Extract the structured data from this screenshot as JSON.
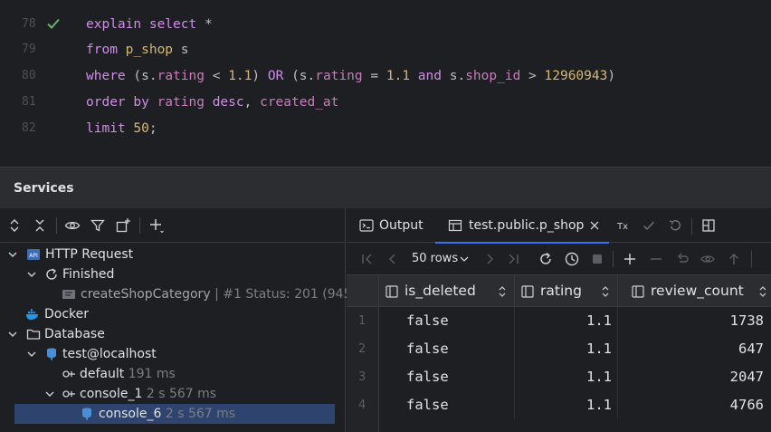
{
  "editor": {
    "lines": [
      {
        "no": "78",
        "status": "check-icon"
      },
      {
        "no": "79"
      },
      {
        "no": "80"
      },
      {
        "no": "81"
      },
      {
        "no": "82"
      }
    ],
    "code": {
      "l78": {
        "a": "explain select",
        "b": "*"
      },
      "l79": {
        "a": "from",
        "b": "p_shop",
        "c": "s"
      },
      "l80": {
        "a": "where",
        "b": "(s.",
        "c": "rating",
        "d": "<",
        "e": "1.1",
        "f": ")",
        "g": "OR",
        "h": "(s.",
        "i": "rating",
        "j": "=",
        "k": "1.1",
        "l": "and",
        "m": "s.",
        "n": "shop_id",
        "o": ">",
        "p": "12960943",
        "q": ")"
      },
      "l81": {
        "a": "order by",
        "b": "rating",
        "c": "desc",
        "d": ",",
        "e": "created_at"
      },
      "l82": {
        "a": "limit",
        "b": "50",
        "c": ";"
      }
    }
  },
  "services": {
    "title": "Services",
    "tree": [
      {
        "label": "HTTP Request"
      },
      {
        "label": "Finished"
      },
      {
        "label": "createShopCategory",
        "meta": "| #1 Status: 201 (945"
      },
      {
        "label": "Docker"
      },
      {
        "label": "Database"
      },
      {
        "label": "test@localhost"
      },
      {
        "label": "default",
        "meta": "191 ms"
      },
      {
        "label": "console_1",
        "meta": "2 s 567 ms"
      },
      {
        "label": "console_6",
        "meta": "2 s 567 ms"
      }
    ]
  },
  "results": {
    "tabs": [
      {
        "label": "Output"
      },
      {
        "label": "test.public.p_shop"
      }
    ],
    "rows_selector": "50 rows",
    "columns": [
      "is_deleted",
      "rating",
      "review_count"
    ],
    "rows": [
      {
        "n": "1",
        "is_deleted": "false",
        "rating": "1.1",
        "review_count": "1738"
      },
      {
        "n": "2",
        "is_deleted": "false",
        "rating": "1.1",
        "review_count": "647"
      },
      {
        "n": "3",
        "is_deleted": "false",
        "rating": "1.1",
        "review_count": "2047"
      },
      {
        "n": "4",
        "is_deleted": "false",
        "rating": "1.1",
        "review_count": "4766"
      }
    ]
  },
  "colors": {
    "accent": "#3574f0",
    "check": "#5fb865",
    "keyword": "#cf8ee8",
    "number": "#d5b778"
  }
}
